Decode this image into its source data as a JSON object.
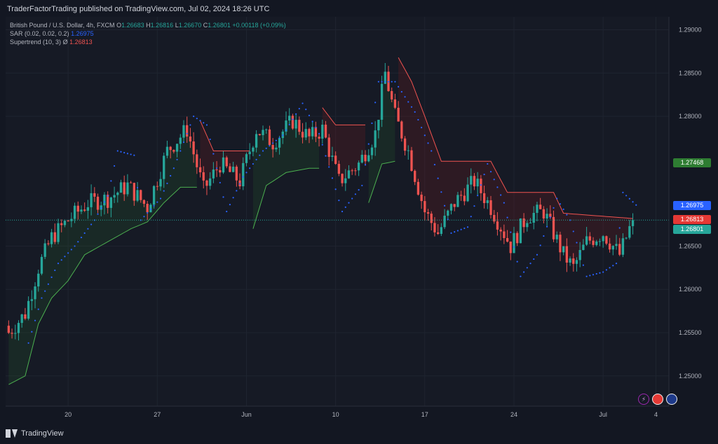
{
  "header": {
    "publisher": "TraderFactorTrading published on TradingView.com, Jul 02, 2024 18:26 UTC"
  },
  "legend": {
    "symbol": "British Pound / U.S. Dollar, 4h, FXCM",
    "o_label": "O",
    "o": "1.26683",
    "h_label": "H",
    "h": "1.26816",
    "l_label": "L",
    "l": "1.26670",
    "c_label": "C",
    "c": "1.26801",
    "change": "+0.00118 (+0.09%)",
    "sar_label": "SAR (0.02, 0.02, 0.2)",
    "sar_value": "1.26975",
    "st_label": "Supertrend (10, 3)",
    "st_sym": "Ø",
    "st_value": "1.26813"
  },
  "price_tags": [
    {
      "value": "1.27468",
      "price": 1.27468,
      "color": "#2e7d32"
    },
    {
      "value": "1.26975",
      "price": 1.26975,
      "color": "#2962ff"
    },
    {
      "value": "1.26813",
      "price": 1.26813,
      "color": "#e53935"
    },
    {
      "value": "1.26801",
      "price": 1.26801,
      "color": "#26a69a"
    }
  ],
  "footer": {
    "brand": "TradingView"
  },
  "icons": [
    "lightning-icon",
    "flag-us-icon",
    "flag-uk-icon"
  ],
  "chart_data": {
    "type": "candlestick",
    "ylim": [
      1.2465,
      1.2915
    ],
    "y_ticks": [
      {
        "value": 1.29,
        "label": "1.29000"
      },
      {
        "value": 1.285,
        "label": "1.28500"
      },
      {
        "value": 1.28,
        "label": "1.28000"
      },
      {
        "value": 1.265,
        "label": "1.26500"
      },
      {
        "value": 1.26,
        "label": "1.26000"
      },
      {
        "value": 1.255,
        "label": "1.25500"
      },
      {
        "value": 1.25,
        "label": "1.25000"
      }
    ],
    "x_ticks": [
      {
        "index": 18,
        "label": "20"
      },
      {
        "index": 45,
        "label": "27"
      },
      {
        "index": 72,
        "label": "Jun"
      },
      {
        "index": 99,
        "label": "10"
      },
      {
        "index": 126,
        "label": "17"
      },
      {
        "index": 153,
        "label": "24"
      },
      {
        "index": 180,
        "label": "Jul"
      },
      {
        "index": 196,
        "label": "4"
      }
    ],
    "last_close": 1.26801,
    "key_closes": [
      {
        "i": 0,
        "c": 1.255
      },
      {
        "i": 5,
        "c": 1.2572
      },
      {
        "i": 9,
        "c": 1.2625
      },
      {
        "i": 13,
        "c": 1.266
      },
      {
        "i": 18,
        "c": 1.268
      },
      {
        "i": 24,
        "c": 1.27
      },
      {
        "i": 30,
        "c": 1.2705
      },
      {
        "i": 36,
        "c": 1.272
      },
      {
        "i": 42,
        "c": 1.2695
      },
      {
        "i": 48,
        "c": 1.276
      },
      {
        "i": 54,
        "c": 1.2785
      },
      {
        "i": 59,
        "c": 1.2715
      },
      {
        "i": 64,
        "c": 1.2745
      },
      {
        "i": 70,
        "c": 1.2725
      },
      {
        "i": 75,
        "c": 1.2785
      },
      {
        "i": 80,
        "c": 1.277
      },
      {
        "i": 86,
        "c": 1.2795
      },
      {
        "i": 91,
        "c": 1.2775
      },
      {
        "i": 95,
        "c": 1.2785
      },
      {
        "i": 100,
        "c": 1.2725
      },
      {
        "i": 106,
        "c": 1.2745
      },
      {
        "i": 111,
        "c": 1.278
      },
      {
        "i": 114,
        "c": 1.285
      },
      {
        "i": 117,
        "c": 1.28
      },
      {
        "i": 121,
        "c": 1.276
      },
      {
        "i": 126,
        "c": 1.269
      },
      {
        "i": 130,
        "c": 1.2665
      },
      {
        "i": 135,
        "c": 1.27
      },
      {
        "i": 141,
        "c": 1.2725
      },
      {
        "i": 146,
        "c": 1.2695
      },
      {
        "i": 152,
        "c": 1.265
      },
      {
        "i": 157,
        "c": 1.2685
      },
      {
        "i": 162,
        "c": 1.269
      },
      {
        "i": 168,
        "c": 1.264
      },
      {
        "i": 171,
        "c": 1.2625
      },
      {
        "i": 175,
        "c": 1.2655
      },
      {
        "i": 180,
        "c": 1.2665
      },
      {
        "i": 185,
        "c": 1.264
      },
      {
        "i": 189,
        "c": 1.26801
      }
    ],
    "supertrend": [
      {
        "i": 0,
        "v": 1.249,
        "dir": "up"
      },
      {
        "i": 5,
        "v": 1.25,
        "dir": "up"
      },
      {
        "i": 9,
        "v": 1.256,
        "dir": "up"
      },
      {
        "i": 13,
        "v": 1.259,
        "dir": "up"
      },
      {
        "i": 18,
        "v": 1.261,
        "dir": "up"
      },
      {
        "i": 23,
        "v": 1.264,
        "dir": "up"
      },
      {
        "i": 30,
        "v": 1.2655,
        "dir": "up"
      },
      {
        "i": 37,
        "v": 1.267,
        "dir": "up"
      },
      {
        "i": 42,
        "v": 1.2678,
        "dir": "up"
      },
      {
        "i": 47,
        "v": 1.27,
        "dir": "up"
      },
      {
        "i": 52,
        "v": 1.2718,
        "dir": "up"
      },
      {
        "i": 57,
        "v": 1.2718,
        "dir": "up"
      },
      {
        "i": 58,
        "v": 1.2795,
        "dir": "down"
      },
      {
        "i": 62,
        "v": 1.276,
        "dir": "down"
      },
      {
        "i": 69,
        "v": 1.276,
        "dir": "down"
      },
      {
        "i": 73,
        "v": 1.276,
        "dir": "down"
      },
      {
        "i": 74,
        "v": 1.267,
        "dir": "up"
      },
      {
        "i": 78,
        "v": 1.272,
        "dir": "up"
      },
      {
        "i": 84,
        "v": 1.2735,
        "dir": "up"
      },
      {
        "i": 91,
        "v": 1.274,
        "dir": "up"
      },
      {
        "i": 94,
        "v": 1.274,
        "dir": "up"
      },
      {
        "i": 95,
        "v": 1.281,
        "dir": "down"
      },
      {
        "i": 99,
        "v": 1.279,
        "dir": "down"
      },
      {
        "i": 108,
        "v": 1.279,
        "dir": "down"
      },
      {
        "i": 109,
        "v": 1.27,
        "dir": "up"
      },
      {
        "i": 113,
        "v": 1.2745,
        "dir": "up"
      },
      {
        "i": 117,
        "v": 1.2748,
        "dir": "up"
      },
      {
        "i": 118,
        "v": 1.2868,
        "dir": "down"
      },
      {
        "i": 122,
        "v": 1.284,
        "dir": "down"
      },
      {
        "i": 126,
        "v": 1.28,
        "dir": "down"
      },
      {
        "i": 131,
        "v": 1.2748,
        "dir": "down"
      },
      {
        "i": 146,
        "v": 1.2748,
        "dir": "down"
      },
      {
        "i": 151,
        "v": 1.2712,
        "dir": "down"
      },
      {
        "i": 165,
        "v": 1.2712,
        "dir": "down"
      },
      {
        "i": 168,
        "v": 1.2688,
        "dir": "down"
      },
      {
        "i": 191,
        "v": 1.26813,
        "dir": "down"
      }
    ],
    "sar": [
      {
        "i": 6,
        "v": 1.2538
      },
      {
        "i": 10,
        "v": 1.259
      },
      {
        "i": 15,
        "v": 1.263
      },
      {
        "i": 20,
        "v": 1.265
      },
      {
        "i": 26,
        "v": 1.268
      },
      {
        "i": 30,
        "v": 1.2708
      },
      {
        "i": 33,
        "v": 1.276
      },
      {
        "i": 38,
        "v": 1.2755
      },
      {
        "i": 40,
        "v": 1.268
      },
      {
        "i": 46,
        "v": 1.2705
      },
      {
        "i": 50,
        "v": 1.274
      },
      {
        "i": 56,
        "v": 1.28
      },
      {
        "i": 60,
        "v": 1.279
      },
      {
        "i": 66,
        "v": 1.269
      },
      {
        "i": 71,
        "v": 1.273
      },
      {
        "i": 77,
        "v": 1.276
      },
      {
        "i": 83,
        "v": 1.2778
      },
      {
        "i": 89,
        "v": 1.2815
      },
      {
        "i": 94,
        "v": 1.278
      },
      {
        "i": 101,
        "v": 1.269
      },
      {
        "i": 107,
        "v": 1.272
      },
      {
        "i": 112,
        "v": 1.284
      },
      {
        "i": 117,
        "v": 1.284
      },
      {
        "i": 123,
        "v": 1.2805
      },
      {
        "i": 128,
        "v": 1.276
      },
      {
        "i": 134,
        "v": 1.2665
      },
      {
        "i": 139,
        "v": 1.2672
      },
      {
        "i": 145,
        "v": 1.2745
      },
      {
        "i": 150,
        "v": 1.27
      },
      {
        "i": 155,
        "v": 1.2615
      },
      {
        "i": 160,
        "v": 1.264
      },
      {
        "i": 166,
        "v": 1.2705
      },
      {
        "i": 170,
        "v": 1.268
      },
      {
        "i": 175,
        "v": 1.2615
      },
      {
        "i": 180,
        "v": 1.262
      },
      {
        "i": 184,
        "v": 1.263
      },
      {
        "i": 186,
        "v": 1.2712
      },
      {
        "i": 190,
        "v": 1.26975
      }
    ]
  }
}
